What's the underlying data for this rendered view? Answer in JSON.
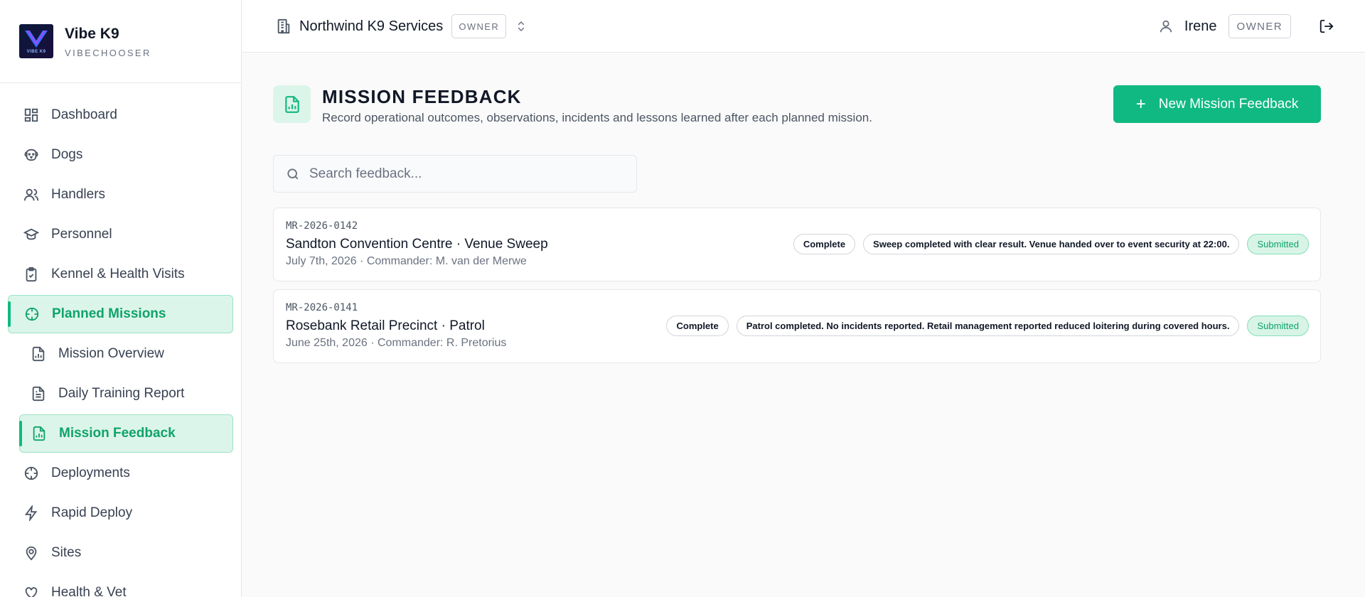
{
  "brand": {
    "name": "Vibe K9",
    "subtitle": "VIBECHOOSER",
    "logo_text": "VIBE K9"
  },
  "sidebar": {
    "items": [
      {
        "label": "Dashboard",
        "icon": "dashboard-icon"
      },
      {
        "label": "Dogs",
        "icon": "dog-icon"
      },
      {
        "label": "Handlers",
        "icon": "users-icon"
      },
      {
        "label": "Personnel",
        "icon": "graduation-cap-icon"
      },
      {
        "label": "Kennel & Health Visits",
        "icon": "clipboard-check-icon"
      },
      {
        "label": "Planned Missions",
        "icon": "crosshair-icon",
        "active": true
      },
      {
        "label": "Mission Overview",
        "icon": "file-chart-icon",
        "sub": true
      },
      {
        "label": "Daily Training Report",
        "icon": "file-text-icon",
        "sub": true
      },
      {
        "label": "Mission Feedback",
        "icon": "file-chart-icon",
        "sub": true,
        "active": true
      },
      {
        "label": "Deployments",
        "icon": "crosshair-icon"
      },
      {
        "label": "Rapid Deploy",
        "icon": "zap-icon"
      },
      {
        "label": "Sites",
        "icon": "map-pin-icon"
      },
      {
        "label": "Health & Vet",
        "icon": "health-icon"
      }
    ]
  },
  "topbar": {
    "org_name": "Northwind K9 Services",
    "org_role": "OWNER",
    "user_name": "Irene",
    "user_role": "OWNER"
  },
  "page": {
    "title": "MISSION FEEDBACK",
    "description": "Record operational outcomes, observations, incidents and lessons learned after each planned mission.",
    "new_button_label": "New Mission Feedback",
    "search_placeholder": "Search feedback..."
  },
  "feedback": [
    {
      "code": "MR-2026-0142",
      "title": "Sandton Convention Centre · Venue Sweep",
      "meta": "July 7th, 2026 · Commander: M. van der Merwe",
      "outcome": "Complete",
      "summary": "Sweep completed with clear result. Venue handed over to event security at 22:00.",
      "status": "Submitted"
    },
    {
      "code": "MR-2026-0141",
      "title": "Rosebank Retail Precinct · Patrol",
      "meta": "June 25th, 2026 · Commander: R. Pretorius",
      "outcome": "Complete",
      "summary": "Patrol completed. No incidents reported. Retail management reported reduced loitering during covered hours.",
      "status": "Submitted"
    }
  ],
  "colors": {
    "accent": "#10b981",
    "accent_light": "#dcf5ea"
  }
}
